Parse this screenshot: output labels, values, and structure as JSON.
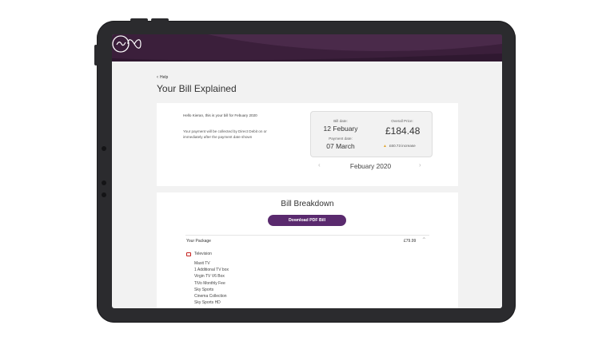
{
  "app": {
    "brand": "Virgin media"
  },
  "colors": {
    "header": "#3b1f3b",
    "accent": "#5a2a6e",
    "warning": "#e0a32a"
  },
  "nav": {
    "back_label": "Help"
  },
  "page": {
    "title": "Your Bill Explained"
  },
  "intro": {
    "greeting": "Hello Kieran, this is your bill for Febuary 2020",
    "payment_note": "Your payment will be collected by Direct Debit on or immediately after the payment date shown"
  },
  "summary": {
    "bill_date_label": "Bill date:",
    "bill_date": "12 Febuary",
    "payment_date_label": "Payment date:",
    "payment_date": "07 March",
    "overall_price_label": "Overall Price:",
    "overall_price": "£184.48",
    "increase": "£60.73 increase"
  },
  "month_nav": {
    "current": "Febuary 2020"
  },
  "breakdown": {
    "title": "Bill Breakdown",
    "download_label": "Download PDF Bill",
    "package_label": "Your Package",
    "package_price": "£79.99",
    "section_label": "Television",
    "items": [
      "Maxit TV",
      "1 Additional TV box",
      "Virgin TV V6 Box",
      "TiVo Monthly Fee",
      "Sky Sports",
      "Cinema Collection",
      "Sky Sports HD"
    ]
  }
}
